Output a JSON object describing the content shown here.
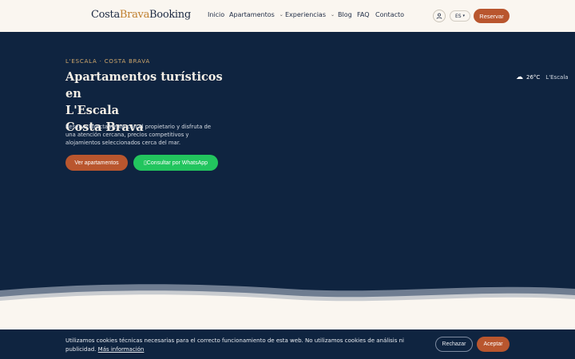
{
  "header": {
    "logo": {
      "part1": "Costa",
      "part2": "Brava",
      "part3": "Booking"
    },
    "nav": {
      "inicio": "Inicio",
      "apartamentos": "Apartamentos",
      "experiencias": "Experiencias",
      "blog": "Blog",
      "faq": "FAQ",
      "contacto": "Contacto"
    },
    "user_icon": "user-icon",
    "language": "ES",
    "reserve_label": "Reservar"
  },
  "hero": {
    "eyebrow": "L'ESCALA · COSTA BRAVA",
    "title": "Apartamentos turísticos en\nL'Escala\nCosta Brava",
    "description": "Reserva directamente con el propietario y disfruta de una atención cercana, precios competitivos y alojamientos seleccionados cerca del mar.",
    "primary_button": "Ver apartamentos",
    "whatsapp_button": "Consultar por WhatsApp",
    "whatsapp_icon": "▯"
  },
  "weather": {
    "icon": "cloud-icon",
    "glyph": "☁",
    "temperature": "26°C",
    "city": "L'Escala"
  },
  "cookie": {
    "text": "Utilizamos cookies técnicas necesarias para el correcto funcionamiento de esta web. No utilizamos cookies de análisis ni publicidad.",
    "link": "Más información",
    "reject": "Rechazar",
    "accept": "Aceptar"
  },
  "colors": {
    "navy": "#0f2440",
    "cream": "#faf6f0",
    "terracotta": "#b9562e",
    "gold": "#c0802f",
    "whatsapp": "#22c55e"
  }
}
